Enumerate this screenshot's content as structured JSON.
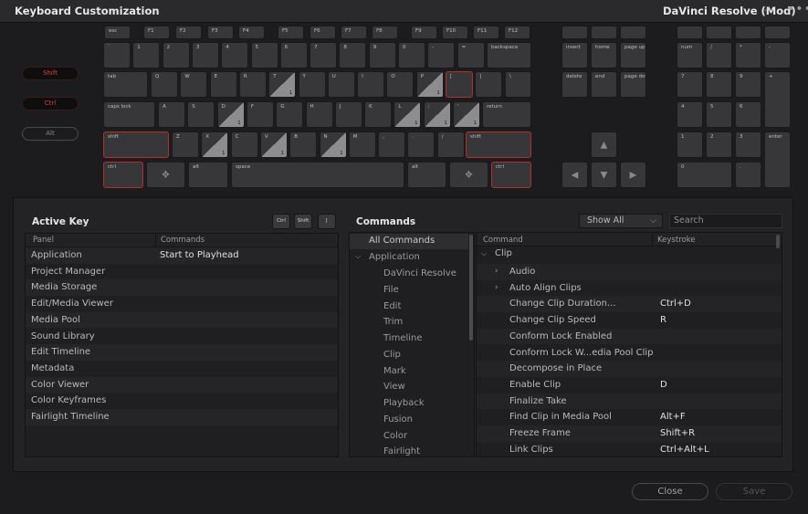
{
  "window": {
    "title": "Keyboard Customization",
    "preset": "DaVinci Resolve (Mod)",
    "preset_chevron_icon": "chevron-down-icon",
    "more_icon": "more-horizontal-icon"
  },
  "modifiers": [
    {
      "label": "Shift",
      "active": true
    },
    {
      "label": "Ctrl",
      "active": true
    },
    {
      "label": "Alt",
      "active": false
    }
  ],
  "keyboard": {
    "function_row": [
      "esc",
      "F1",
      "F2",
      "F3",
      "F4",
      "F5",
      "F6",
      "F7",
      "F8",
      "F9",
      "F10",
      "F11",
      "F12"
    ],
    "number_row": [
      "`",
      "1",
      "2",
      "3",
      "4",
      "5",
      "6",
      "7",
      "8",
      "9",
      "0",
      "-",
      "=",
      "backspace"
    ],
    "tab_row": [
      "tab",
      "Q",
      "W",
      "E",
      "R",
      "T",
      "Y",
      "U",
      "I",
      "O",
      "P",
      "[",
      "]",
      "\\"
    ],
    "caps_row": [
      "caps lock",
      "A",
      "S",
      "D",
      "F",
      "G",
      "H",
      "J",
      "K",
      "L",
      ";",
      "'",
      "return"
    ],
    "shift_row": [
      "shift",
      "Z",
      "X",
      "C",
      "V",
      "B",
      "N",
      "M",
      ",",
      ".",
      "/",
      "shift"
    ],
    "bottom_row": [
      "ctrl",
      "alt",
      "space",
      "alt",
      "ctrl"
    ],
    "nav_top": [
      "insert",
      "home",
      "page up"
    ],
    "nav_bottom": [
      "delete",
      "end",
      "page down"
    ],
    "numpad_row1": [
      "num",
      "/",
      "*",
      "-"
    ],
    "numpad_row2": [
      "7",
      "8",
      "9",
      "+"
    ],
    "numpad_row3": [
      "4",
      "5",
      "6"
    ],
    "numpad_row4": [
      "1",
      "2",
      "3",
      "enter"
    ],
    "numpad_row5": [
      "0",
      "."
    ],
    "assigned_count": "1",
    "arrow_up": "▲",
    "arrow_left": "◀",
    "arrow_down": "▼",
    "arrow_right": "▶"
  },
  "active_key": {
    "title": "Active Key",
    "buttons": [
      "Ctrl",
      "Shift",
      "["
    ],
    "col_panel": "Panel",
    "col_commands": "Commands",
    "rows": [
      {
        "panel": "Application",
        "command": "Start to Playhead"
      },
      {
        "panel": "Project Manager",
        "command": ""
      },
      {
        "panel": "Media Storage",
        "command": ""
      },
      {
        "panel": "Edit/Media Viewer",
        "command": ""
      },
      {
        "panel": "Media Pool",
        "command": ""
      },
      {
        "panel": "Sound Library",
        "command": ""
      },
      {
        "panel": "Edit Timeline",
        "command": ""
      },
      {
        "panel": "Metadata",
        "command": ""
      },
      {
        "panel": "Color Viewer",
        "command": ""
      },
      {
        "panel": "Color Keyframes",
        "command": ""
      },
      {
        "panel": "Fairlight Timeline",
        "command": ""
      }
    ]
  },
  "commands": {
    "title": "Commands",
    "filter": "Show All",
    "search_placeholder": "Search",
    "tree_all": "All Commands",
    "tree_app": "Application",
    "tree_children": [
      "DaVinci Resolve",
      "File",
      "Edit",
      "Trim",
      "Timeline",
      "Clip",
      "Mark",
      "View",
      "Playback",
      "Fusion",
      "Color",
      "Fairlight"
    ],
    "col_command": "Command",
    "col_keystroke": "Keystroke",
    "group": "Clip",
    "rows": [
      {
        "command": "Audio",
        "key": "",
        "expandable": true
      },
      {
        "command": "Auto Align Clips",
        "key": "",
        "expandable": true
      },
      {
        "command": "Change Clip Duration...",
        "key": "Ctrl+D",
        "expandable": false
      },
      {
        "command": "Change Clip Speed",
        "key": "R",
        "expandable": false
      },
      {
        "command": "Conform Lock Enabled",
        "key": "",
        "expandable": false
      },
      {
        "command": "Conform Lock W...edia Pool Clip",
        "key": "",
        "expandable": false
      },
      {
        "command": "Decompose in Place",
        "key": "",
        "expandable": false
      },
      {
        "command": "Enable Clip",
        "key": "D",
        "expandable": false
      },
      {
        "command": "Finalize Take",
        "key": "",
        "expandable": false
      },
      {
        "command": "Find Clip in Media Pool",
        "key": "Alt+F",
        "expandable": false
      },
      {
        "command": "Freeze Frame",
        "key": "Shift+R",
        "expandable": false
      },
      {
        "command": "Link Clips",
        "key": "Ctrl+Alt+L",
        "expandable": false
      }
    ]
  },
  "footer": {
    "close": "Close",
    "save": "Save"
  }
}
